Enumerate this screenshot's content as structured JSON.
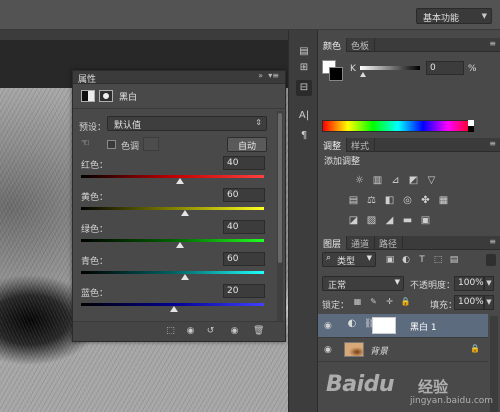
{
  "topbar": {
    "workspace": "基本功能"
  },
  "properties": {
    "title": "属性",
    "adj_name": "黑白",
    "preset_label": "预设：",
    "preset_value": "默认值",
    "tint_label": "色调",
    "auto_label": "自动",
    "sliders": [
      {
        "label": "红色：",
        "value": "40",
        "level": 0.54
      },
      {
        "label": "黄色：",
        "value": "60",
        "level": 0.57
      },
      {
        "label": "绿色：",
        "value": "40",
        "level": 0.54
      },
      {
        "label": "青色：",
        "value": "60",
        "level": 0.57
      },
      {
        "label": "蓝色：",
        "value": "20",
        "level": 0.51
      }
    ]
  },
  "color_panel": {
    "tabs": [
      "颜色",
      "色板"
    ],
    "channel_label": "K",
    "channel_value": "0",
    "unit": "%"
  },
  "adjustments_panel": {
    "tabs": [
      "调整",
      "样式"
    ],
    "add_label": "添加调整"
  },
  "layers_panel": {
    "tabs": [
      "图层",
      "通道",
      "路径"
    ],
    "kind": "类型",
    "blend_mode": "正常",
    "opacity_label": "不透明度：",
    "opacity_value": "100%",
    "lock_label": "锁定：",
    "fill_label": "填充：",
    "fill_value": "100%",
    "layers": [
      {
        "name": "黑白 1",
        "selected": true
      },
      {
        "name": "背景",
        "selected": false
      }
    ]
  },
  "watermark": {
    "brand": "Baidu",
    "jy": "经验",
    "url": "jingyan.baidu.com"
  },
  "colors": {
    "accent_selected_row": "#5d6b7f"
  }
}
